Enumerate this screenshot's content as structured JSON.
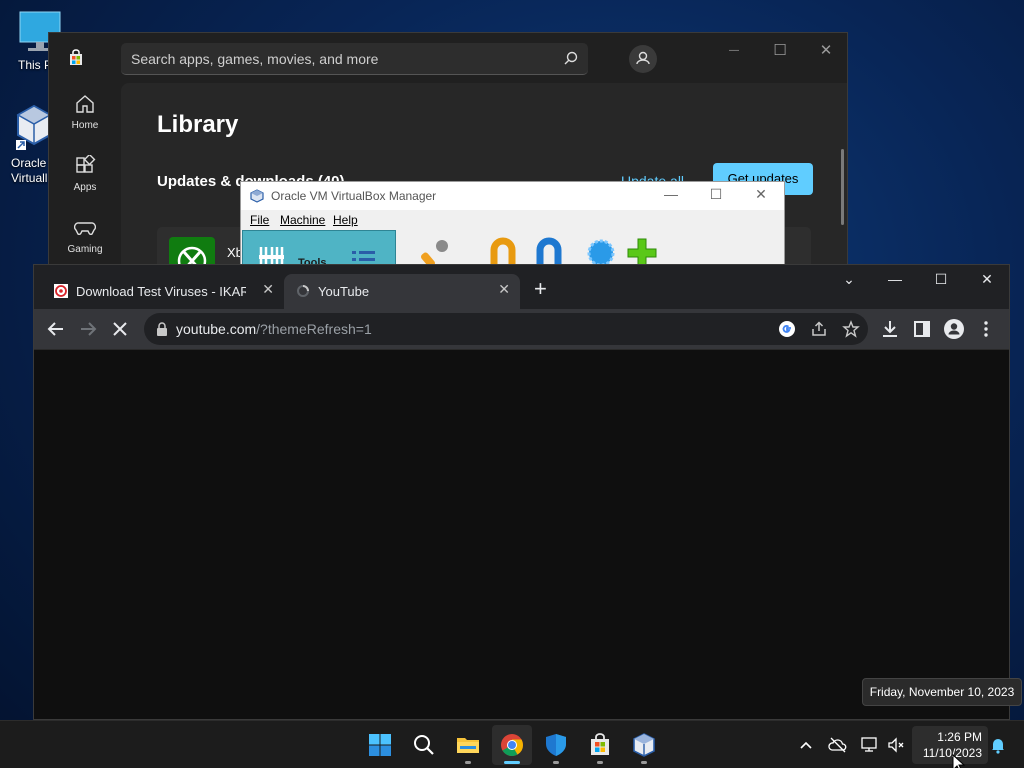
{
  "desktop": {
    "icons": [
      {
        "label": "This P",
        "icon": "monitor-icon"
      },
      {
        "label": "Oracle",
        "label2": "Virtuall",
        "icon": "virtualbox-icon"
      }
    ]
  },
  "store": {
    "search_placeholder": "Search apps, games, movies, and more",
    "rail": [
      {
        "label": "Home",
        "icon": "home-icon"
      },
      {
        "label": "Apps",
        "icon": "apps-icon"
      },
      {
        "label": "Gaming",
        "icon": "gaming-icon"
      }
    ],
    "heading": "Library",
    "subheading": "Updates & downloads (40)",
    "update_all": "Update all",
    "get_updates": "Get updates",
    "row_text": "Xb",
    "controls": {
      "minimize": "—",
      "maximize": "☐",
      "close": "✕"
    }
  },
  "vbox": {
    "title": "Oracle VM VirtualBox Manager",
    "menu": [
      "File",
      "Machine",
      "Help"
    ],
    "tools_label": "Tools"
  },
  "chrome": {
    "tabs": [
      {
        "label": "Download Test Viruses - IKARUS",
        "active": false
      },
      {
        "label": "YouTube",
        "active": true
      }
    ],
    "new_tab": "+",
    "url_host": "youtube.com",
    "url_rest": "/?themeRefresh=1"
  },
  "tooltip": "Friday, November 10, 2023",
  "taskbar": {
    "time": "1:26 PM",
    "date": "11/10/2023",
    "accent": "#60cdff"
  }
}
